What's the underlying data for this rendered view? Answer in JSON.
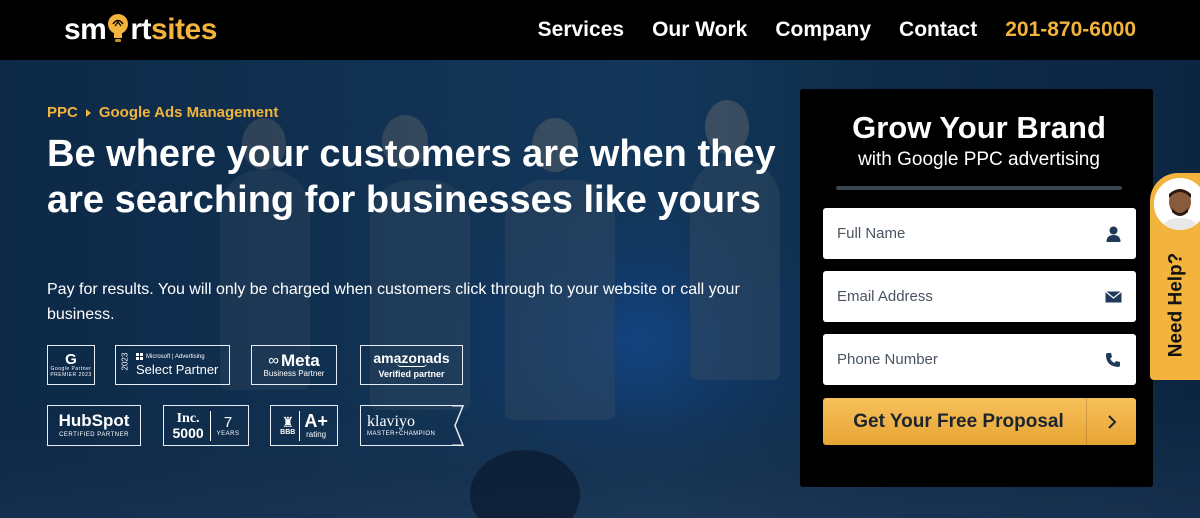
{
  "header": {
    "logo_prefix": "sm",
    "logo_mid": "rt",
    "logo_suffix": "sites",
    "nav": [
      "Services",
      "Our Work",
      "Company",
      "Contact"
    ],
    "phone": "201-870-6000"
  },
  "hero": {
    "breadcrumb": [
      "PPC",
      "Google Ads Management"
    ],
    "headline": "Be where your customers are when they are searching for businesses like yours",
    "subtext": "Pay for results. You will only be charged when customers click through to your website or call your business."
  },
  "badges": {
    "google": {
      "letter": "G",
      "line1": "Google Partner",
      "line2": "PREMIER 2023"
    },
    "microsoft": {
      "year": "2023",
      "brand": "Microsoft | Advertising",
      "title": "Select Partner"
    },
    "meta": {
      "title": "Meta",
      "sub": "Business Partner"
    },
    "amazon": {
      "title": "amazonads",
      "sub": "Verified partner"
    },
    "hubspot": {
      "title": "HubSpot",
      "sub": "CERTIFIED PARTNER"
    },
    "inc": {
      "title": "Inc.",
      "num": "5000",
      "years_num": "7",
      "years_label": "YEARS"
    },
    "bbb": {
      "letters": "BBB",
      "grade": "A+",
      "label": "rating"
    },
    "klaviyo": {
      "title": "klaviyo",
      "sub": "MASTER+CHAMPION"
    }
  },
  "form": {
    "title": "Grow Your Brand",
    "subtitle": "with Google PPC advertising",
    "fields": [
      {
        "placeholder": "Full Name",
        "icon": "user-icon"
      },
      {
        "placeholder": "Email Address",
        "icon": "envelope-icon"
      },
      {
        "placeholder": "Phone Number",
        "icon": "phone-icon"
      }
    ],
    "cta": "Get Your Free Proposal",
    "cta_icon": "chevron-right-icon"
  },
  "help": {
    "label": "Need Help?"
  },
  "colors": {
    "accent": "#f2b43c",
    "topbar": "#000000",
    "panel": "#000000",
    "hero": "#153a5c"
  }
}
